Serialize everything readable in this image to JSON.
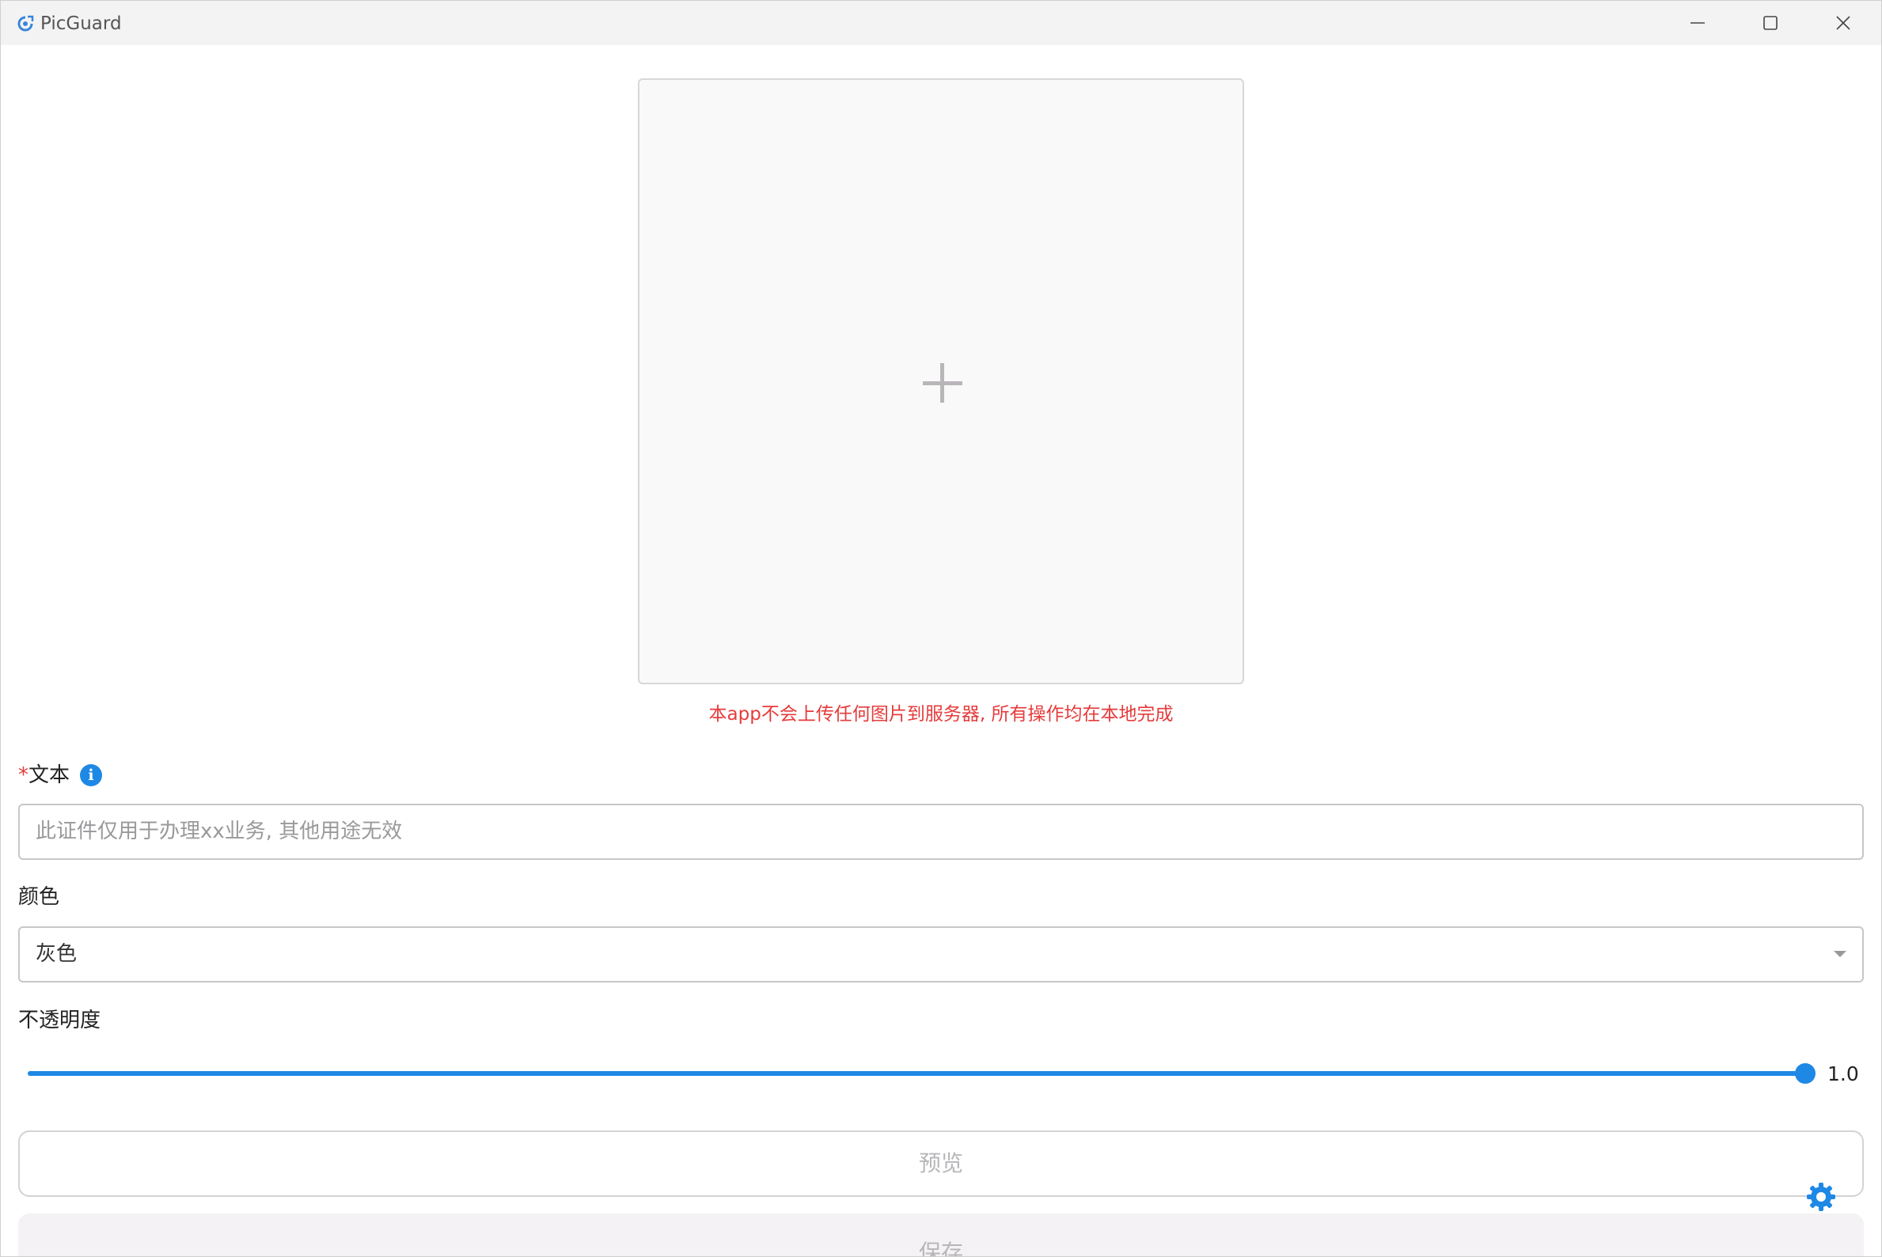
{
  "window": {
    "title": "PicGuard"
  },
  "upload": {
    "notice": "本app不会上传任何图片到服务器, 所有操作均在本地完成"
  },
  "text_field": {
    "required_mark": "*",
    "label": "文本",
    "placeholder": "此证件仅用于办理xx业务, 其他用途无效",
    "value": ""
  },
  "color_field": {
    "label": "颜色",
    "selected": "灰色"
  },
  "opacity": {
    "label": "不透明度",
    "value": 1.0,
    "display": "1.0"
  },
  "buttons": {
    "preview": "预览",
    "save": "保存"
  },
  "colors": {
    "accent": "#1e88e5",
    "notice": "#e53b3b",
    "disabled_text": "#b8b6b9"
  },
  "icons": {
    "app": "picguard-logo-icon",
    "minimize": "minimize-icon",
    "maximize": "maximize-icon",
    "close": "close-icon",
    "add": "plus-icon",
    "info": "info-icon",
    "dropdown": "chevron-down-icon",
    "settings": "gear-icon"
  }
}
